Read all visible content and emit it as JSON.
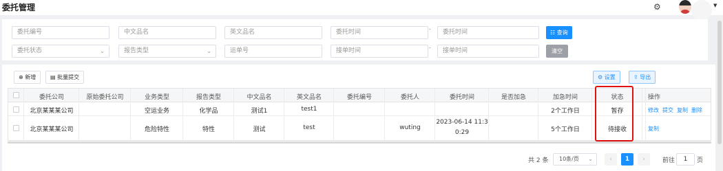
{
  "header": {
    "title": "委托管理",
    "gear_icon": "settings-gear-icon",
    "avatar_icon": "user-avatar-icon"
  },
  "filters": {
    "row1": [
      {
        "placeholder": "委托编号"
      },
      {
        "placeholder": "中文品名"
      },
      {
        "placeholder": "英文品名"
      },
      {
        "placeholder": "委托时间"
      },
      {
        "placeholder": "委托时间"
      }
    ],
    "row2": [
      {
        "placeholder": "委托状态"
      },
      {
        "placeholder": "报告类型"
      },
      {
        "placeholder": "运单号"
      },
      {
        "placeholder": "接单时间"
      },
      {
        "placeholder": "接单时间"
      }
    ],
    "range_separator": "-",
    "search_label": "☷ 查询",
    "clear_label": "清空"
  },
  "toolbar": {
    "add_label": "⊕ 新增",
    "batch_submit_label": "▤ 批量提交",
    "settings_label": "⚙ 设置",
    "export_label": "⇪ 导出"
  },
  "table": {
    "columns": [
      "委托公司",
      "原始委托公司",
      "业务类型",
      "报告类型",
      "中文品名",
      "英文品名",
      "委托编号",
      "委托人",
      "委托时间",
      "是否加急",
      "加急时间",
      "状态",
      "操作"
    ],
    "rows": [
      {
        "company": "北京某某某公司",
        "original_company": "",
        "business_type": "空运业务",
        "report_type": "化学品",
        "cn_name": "测试1",
        "en_name": "test1",
        "order_no": "",
        "client": "",
        "time_line1": "",
        "time_line2": "",
        "urgent": "",
        "urgent_time": "2个工作日",
        "status": "暂存",
        "actions": [
          "修改",
          "提交",
          "复制",
          "删除"
        ]
      },
      {
        "company": "北京某某某公司",
        "original_company": "",
        "business_type": "危险特性",
        "report_type": "特性",
        "cn_name": "测试",
        "en_name": "test",
        "order_no": "",
        "client": "wuting",
        "time_line1": "2023-06-14 11:3",
        "time_line2": "0:29",
        "urgent": "",
        "urgent_time": "5个工作日",
        "status": "待接收",
        "actions": [
          "复制"
        ]
      }
    ]
  },
  "pagination": {
    "total": "共 2 条",
    "page_size": "10条/页",
    "current_page": "1",
    "prev": "‹",
    "next": "›",
    "goto_label": "前往",
    "goto_value": "1",
    "goto_unit": "页"
  },
  "colors": {
    "primary": "#1890ff",
    "highlight": "#e01010",
    "clear_button": "#9da1a7"
  }
}
